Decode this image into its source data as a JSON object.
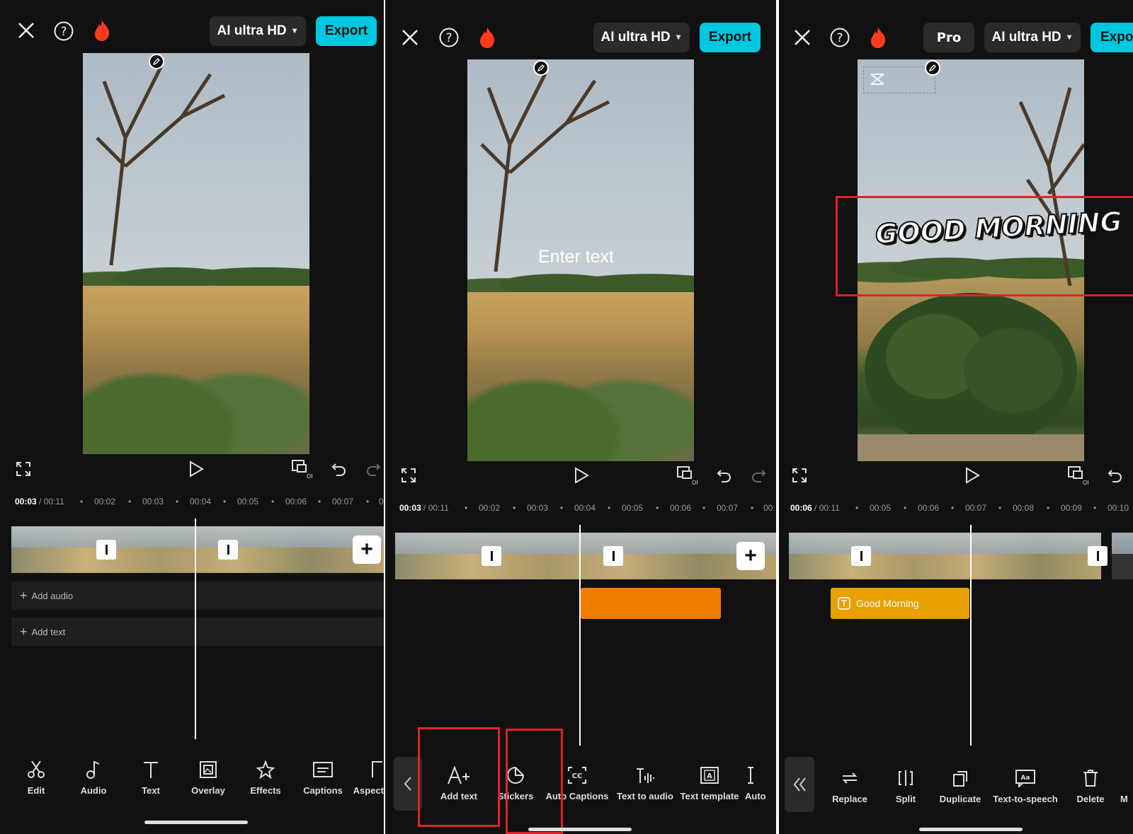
{
  "panel1": {
    "ai_label": "AI ultra HD",
    "export_label": "Export",
    "timecode": {
      "current": "00:03",
      "total": " / 00:11"
    },
    "ruler": [
      "00:02",
      "00:03",
      "00:04",
      "00:05",
      "00:06",
      "00:07",
      "0"
    ],
    "add_audio": "Add audio",
    "add_text": "Add text",
    "tools": [
      "Edit",
      "Audio",
      "Text",
      "Overlay",
      "Effects",
      "Captions",
      "Aspect"
    ]
  },
  "panel2": {
    "ai_label": "AI ultra HD",
    "export_label": "Export",
    "overlay_text": "Enter text",
    "timecode": {
      "current": "00:03",
      "total": " / 00:11"
    },
    "ruler": [
      "00:02",
      "00:03",
      "00:04",
      "00:05",
      "00:06",
      "00:07",
      "00:"
    ],
    "tools": [
      "Add text",
      "Stickers",
      "Auto Captions",
      "Text to audio",
      "Text template",
      "Auto"
    ],
    "text_clip_color": "#f07d00"
  },
  "panel3": {
    "pro_label": "Pro",
    "ai_label": "AI ultra HD",
    "export_label": "Expo",
    "overlay_text": "GOOD MORNING",
    "timecode": {
      "current": "00:06",
      "total": " / 00:11"
    },
    "ruler": [
      "00:05",
      "00:06",
      "00:07",
      "00:08",
      "00:09",
      "00:10"
    ],
    "text_clip_label": "Good Morning",
    "text_clip_color": "#e8a100",
    "tools": [
      "Replace",
      "Split",
      "Duplicate",
      "Text-to-speech",
      "Delete",
      "M"
    ]
  },
  "colors": {
    "accent": "#00c7e0",
    "highlight": "#e0202a",
    "fire": "#ff3b1f"
  }
}
